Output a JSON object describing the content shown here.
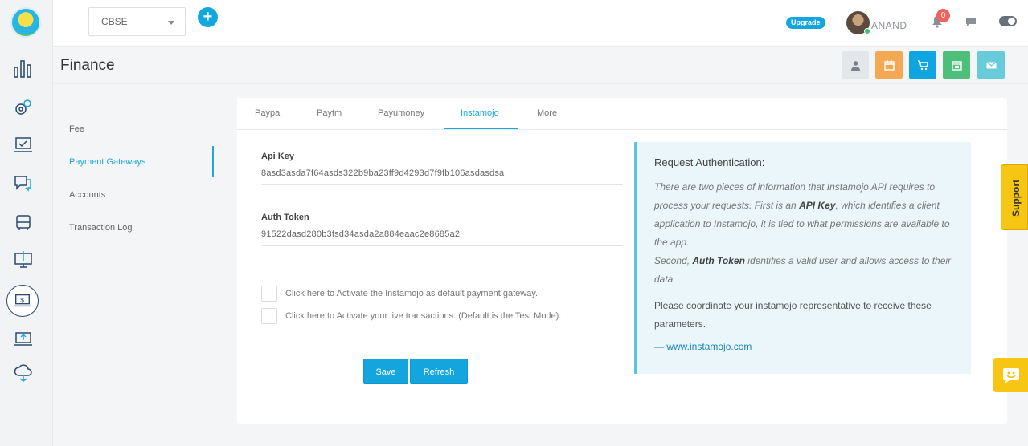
{
  "topbar": {
    "board_select": "CBSE",
    "upgrade_label": "Upgrade",
    "user_name": "ANAND",
    "notification_count": "0"
  },
  "page": {
    "title": "Finance"
  },
  "subnav": {
    "items": [
      "Fee",
      "Payment Gateways",
      "Accounts",
      "Transaction Log"
    ],
    "active": "Payment Gateways"
  },
  "tabs": {
    "items": [
      "Paypal",
      "Paytm",
      "Payumoney",
      "Instamojo",
      "More"
    ],
    "active": "Instamojo"
  },
  "form": {
    "api_key_label": "Api Key",
    "api_key_value": "8asd3asda7f64asds322b9ba23ff9d4293d7f9fb106asdasdsa",
    "auth_token_label": "Auth Token",
    "auth_token_value": "91522dasd280b3fsd34asda2a884eaac2e8685a2",
    "checkbox_default": "Click here to Activate the Instamojo as default payment gateway.",
    "checkbox_live": "Click here to Activate your live transactions. (Default is the Test Mode).",
    "save_label": "Save",
    "refresh_label": "Refresh"
  },
  "info": {
    "title": "Request Authentication:",
    "desc_1": "There are two pieces of information that Instamojo API requires to process your requests. First is an ",
    "desc_api_key": "API Key",
    "desc_2": ", which identifies a client application to Instamojo, it is tied to what permissions are available to the app.",
    "desc_3": "Second, ",
    "desc_auth_token": "Auth Token",
    "desc_4": " identifies a valid user and allows access to their data.",
    "note": "Please coordinate your instamojo representative to receive these parameters.",
    "link": "— www.instamojo.com"
  },
  "support_label": "Support",
  "colors": {
    "accent": "#14a5df",
    "header_buttons": [
      "#e4e7ea",
      "#f3a953",
      "#0fa5e0",
      "#4dbf7a",
      "#67cbd9"
    ],
    "support": "#f6c613"
  },
  "icons": {
    "header_buttons": [
      "user-icon",
      "calendar-icon",
      "cart-icon",
      "calendar-check-icon",
      "mail-icon"
    ]
  }
}
